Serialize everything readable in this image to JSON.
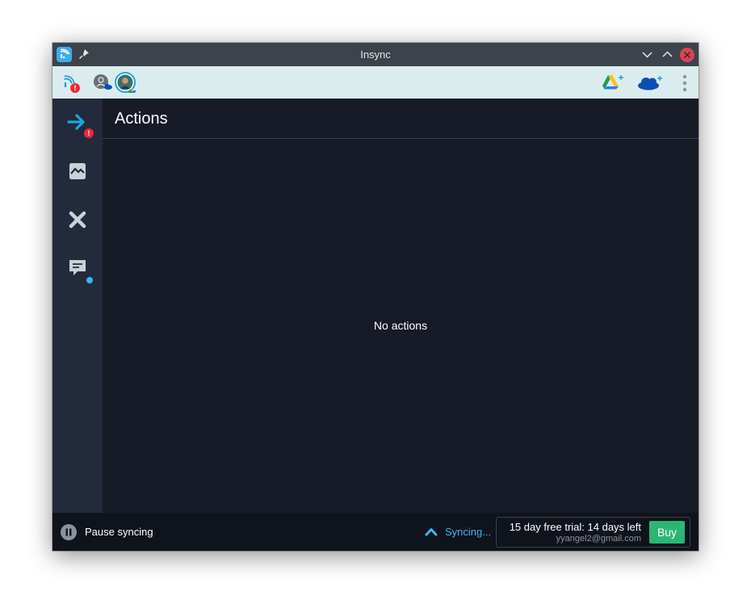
{
  "window": {
    "title": "Insync",
    "app_icon": "insync-logo-icon",
    "controls": [
      "pin-icon",
      "minimize-icon",
      "maximize-icon",
      "close-icon"
    ]
  },
  "account_bar": {
    "status_icon": "sync-signal-icon",
    "status_badge": "!",
    "accounts": [
      "onedrive-account-avatar",
      "gdrive-account-avatar"
    ],
    "add_buttons": [
      "add-google-drive-icon",
      "add-onedrive-icon"
    ],
    "menu_icon": "kebab-menu-icon"
  },
  "sidebar": {
    "items": [
      {
        "name": "actions",
        "icon": "arrow-right-icon",
        "badge": "!"
      },
      {
        "name": "feed",
        "icon": "image-icon"
      },
      {
        "name": "errors",
        "icon": "x-icon"
      },
      {
        "name": "messages",
        "icon": "message-icon",
        "dot": true
      }
    ]
  },
  "main": {
    "title": "Actions",
    "empty_text": "No actions"
  },
  "footer": {
    "pause_label": "Pause syncing",
    "sync_label": "Syncing...",
    "trial_text": "15 day free trial: 14 days left",
    "email": "yyangel2@gmail.com",
    "buy_label": "Buy"
  },
  "colors": {
    "accent": "#3bb7f0",
    "buy": "#2bb673",
    "alert": "#e8283c",
    "background": "#161b27",
    "sidebar": "#232a3b"
  }
}
